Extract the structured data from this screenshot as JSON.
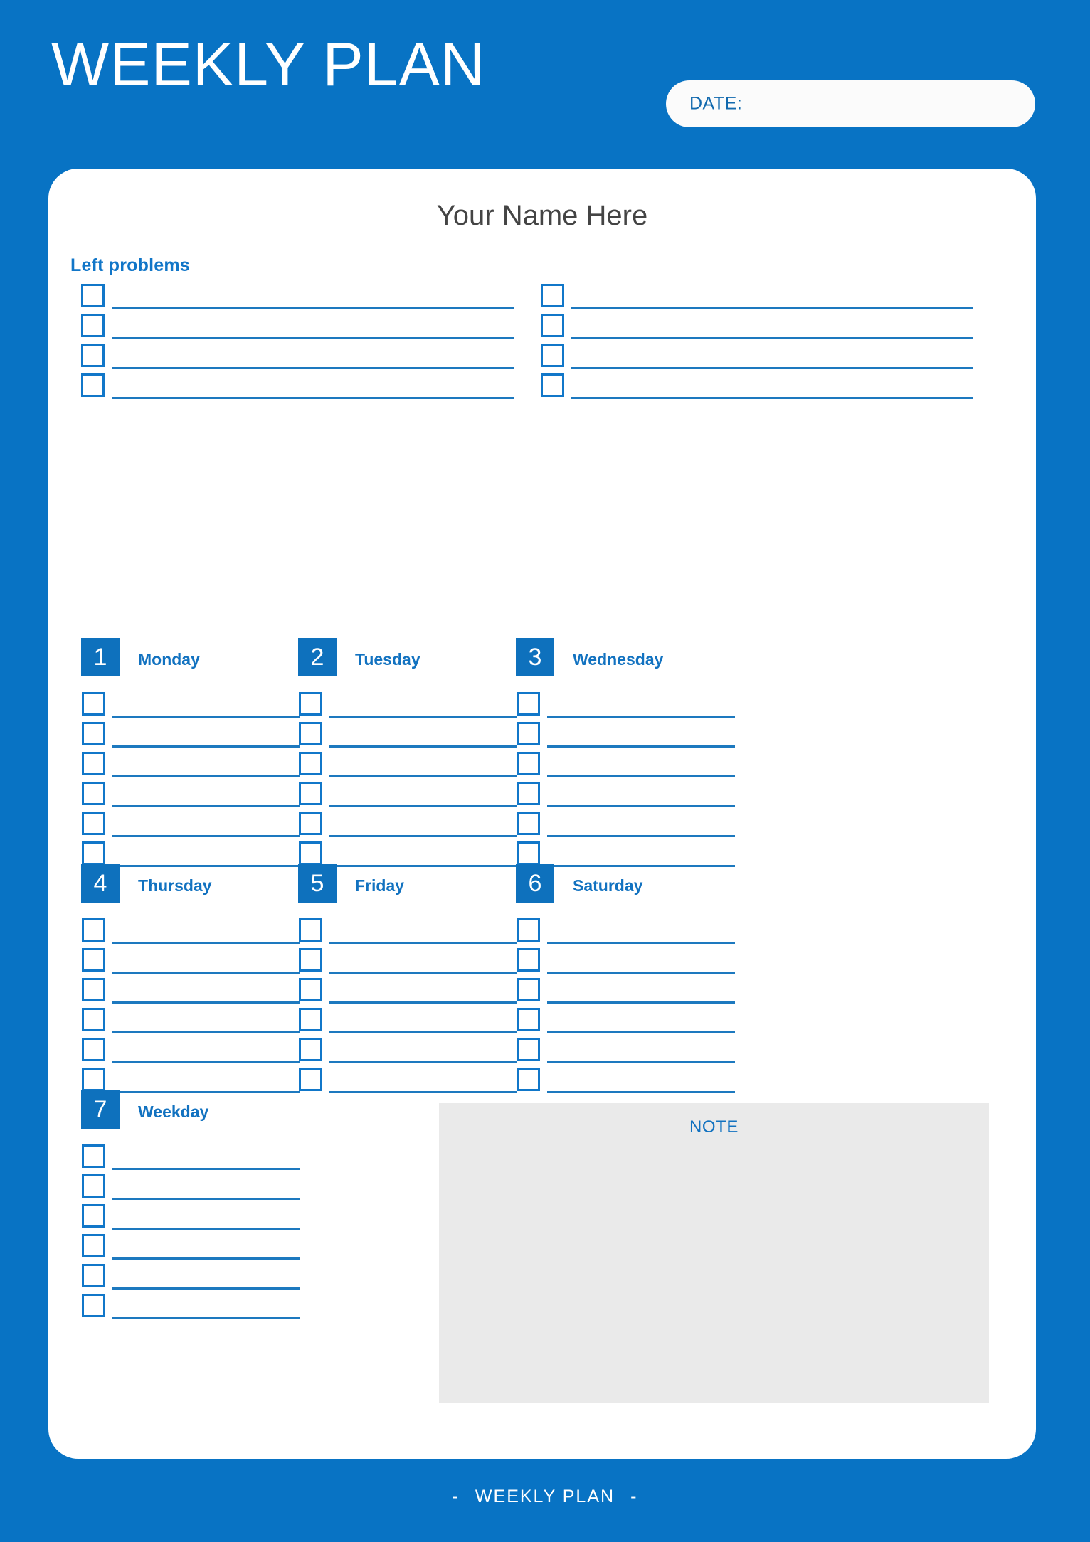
{
  "header": {
    "title": "WEEKLY PLAN",
    "date_label": "DATE:",
    "date_value": ""
  },
  "card": {
    "name_placeholder": "Your Name Here",
    "left_problems_label": "Left problems"
  },
  "left_problems": {
    "rows_per_column": 4,
    "columns": 2,
    "items": [
      "",
      "",
      "",
      "",
      "",
      "",
      "",
      ""
    ]
  },
  "days": [
    {
      "num": "1",
      "name": "Monday",
      "rows": 6,
      "items": [
        "",
        "",
        "",
        "",
        "",
        ""
      ]
    },
    {
      "num": "2",
      "name": "Tuesday",
      "rows": 6,
      "items": [
        "",
        "",
        "",
        "",
        "",
        ""
      ]
    },
    {
      "num": "3",
      "name": "Wednesday",
      "rows": 6,
      "items": [
        "",
        "",
        "",
        "",
        "",
        ""
      ]
    },
    {
      "num": "4",
      "name": "Thursday",
      "rows": 6,
      "items": [
        "",
        "",
        "",
        "",
        "",
        ""
      ]
    },
    {
      "num": "5",
      "name": "Friday",
      "rows": 6,
      "items": [
        "",
        "",
        "",
        "",
        "",
        ""
      ]
    },
    {
      "num": "6",
      "name": "Saturday",
      "rows": 6,
      "items": [
        "",
        "",
        "",
        "",
        "",
        ""
      ]
    },
    {
      "num": "7",
      "name": "Weekday",
      "rows": 6,
      "items": [
        "",
        "",
        "",
        "",
        "",
        ""
      ]
    }
  ],
  "note": {
    "title": "NOTE",
    "content": ""
  },
  "footer": {
    "left_dash": "-",
    "text": "WEEKLY PLAN",
    "right_dash": "-"
  },
  "colors": {
    "brand_blue": "#0873c4",
    "accent_blue": "#1176c8",
    "line_blue": "#1d79bf",
    "day_block_blue": "#0e71bd",
    "card_white": "#ffffff",
    "note_gray": "#eaeaea",
    "name_gray": "#444444"
  }
}
